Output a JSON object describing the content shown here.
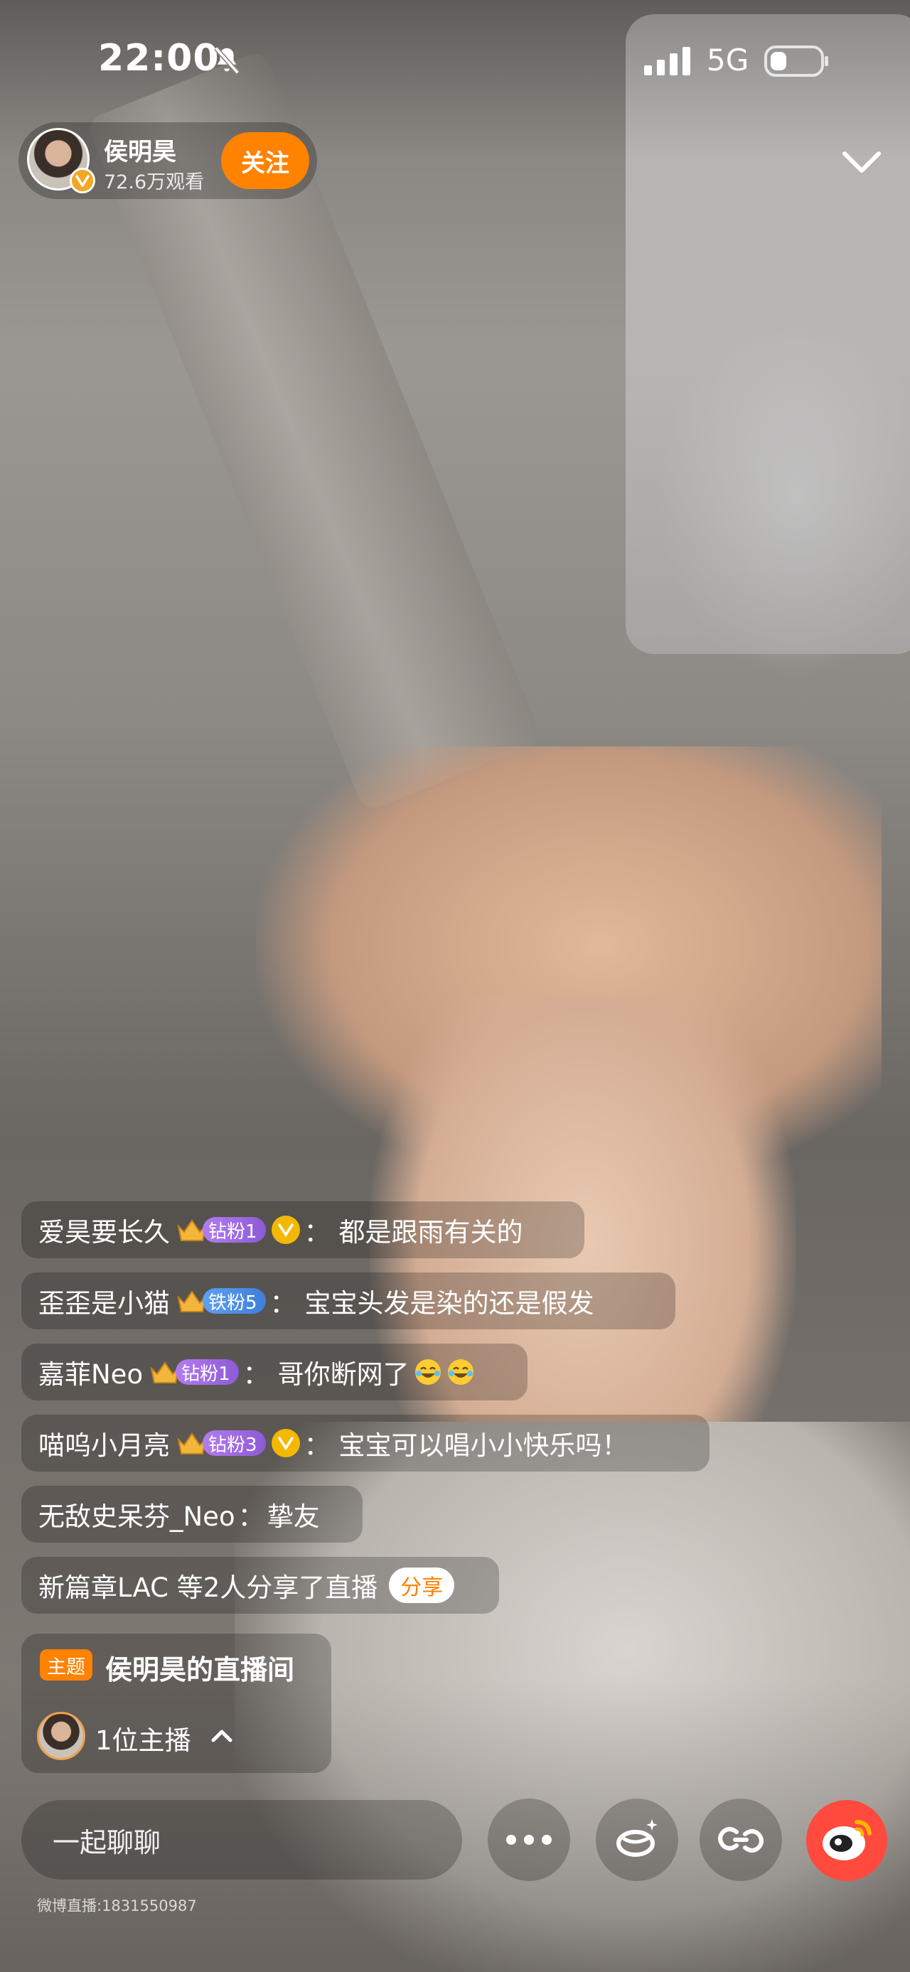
{
  "status_bar": {
    "time": "22:00",
    "network": "5G",
    "icons": [
      "bell-slash-icon",
      "signal-icon",
      "battery-icon"
    ]
  },
  "streamer": {
    "name": "侯明昊",
    "viewers": "72.6万观看",
    "follow_label": "关注"
  },
  "comments": [
    {
      "user": "爱昊要长久",
      "badge": "钻粉1",
      "badge_type": "diamond",
      "verified": true,
      "separator": "：",
      "text": "都是跟雨有关的"
    },
    {
      "user": "歪歪是小猫",
      "badge": "铁粉5",
      "badge_type": "iron",
      "verified": false,
      "separator": "：",
      "text": "宝宝头发是染的还是假发"
    },
    {
      "user": "嘉菲Neo",
      "badge": "钻粉1",
      "badge_type": "diamond",
      "verified": false,
      "separator": "：",
      "text": "哥你断网了",
      "emoji": [
        "laugh-cry-emoji",
        "laugh-cry-emoji"
      ]
    },
    {
      "user": "喵呜小月亮",
      "badge": "钻粉3",
      "badge_type": "diamond",
      "verified": true,
      "separator": "：",
      "text": "宝宝可以唱小小快乐吗！"
    },
    {
      "user": "无敌史呆芬_Neo",
      "separator": "：",
      "text": "挚友"
    }
  ],
  "share_notice": {
    "text": "新篇章LAC 等2人分享了直播",
    "share_label": "分享"
  },
  "topic": {
    "tag": "主题",
    "title": "侯明昊的直播间",
    "host_count": "1位主播"
  },
  "bottom_bar": {
    "chat_placeholder": "一起聊聊",
    "room_id": "微博直播:1831550987",
    "buttons": [
      "more-icon",
      "gift-icon",
      "link-icon",
      "weibo-icon"
    ]
  },
  "colors": {
    "accent": "#ff8200",
    "diamond_badge": "#9b67e0",
    "iron_badge": "#4a8ee0",
    "verified": "#f5b800"
  }
}
